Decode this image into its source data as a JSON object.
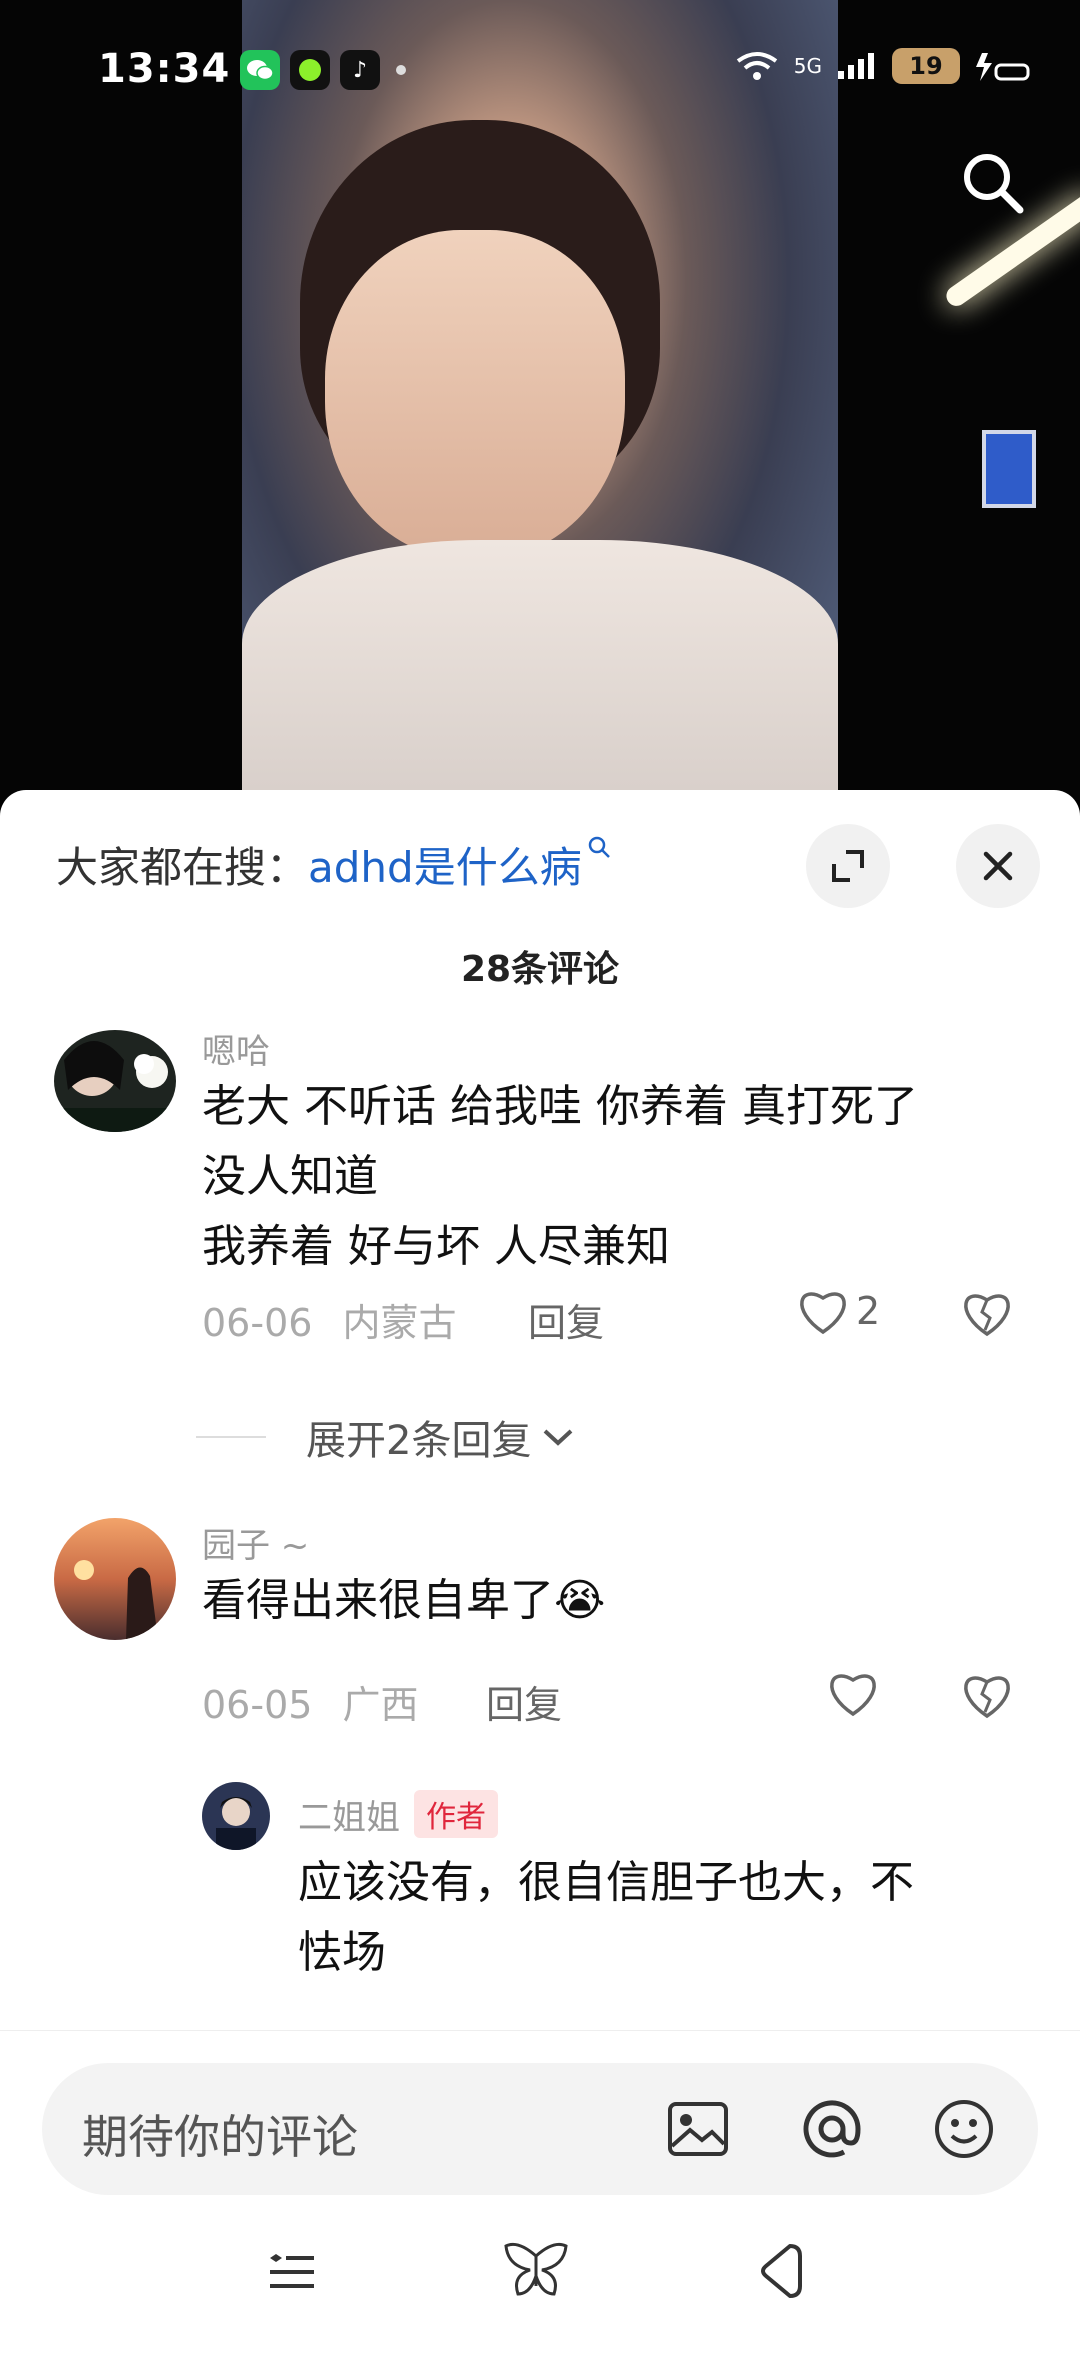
{
  "status_bar": {
    "time": "13:34",
    "network": "5G",
    "battery": "19"
  },
  "icons": {
    "search": "search-icon",
    "expand": "expand-icon",
    "close": "close-icon",
    "like": "heart-icon",
    "dislike": "broken-heart-icon",
    "image": "image-icon",
    "mention": "at-icon",
    "emoji": "smiley-icon"
  },
  "sheet": {
    "hot_search_prefix": "大家都在搜：",
    "hot_search_keyword": "adhd是什么病",
    "comment_count": "28条评论"
  },
  "comments": [
    {
      "username": "嗯哈",
      "lines": [
        "老大 不听话 给我哇  你养着 真打死了",
        "没人知道",
        "我养着 好与坏 人尽兼知"
      ],
      "date": "06-06",
      "location": "内蒙古",
      "reply_label": "回复",
      "likes": "2",
      "expand_label": "展开2条回复"
    },
    {
      "username": "园子 ~",
      "lines": [
        "看得出来很自卑了😭"
      ],
      "date": "06-05",
      "location": "广西",
      "reply_label": "回复",
      "likes": ""
    }
  ],
  "reply": {
    "username": "二姐姐",
    "badge": "作者",
    "lines": [
      "应该没有，很自信胆子也大，不",
      "怯场"
    ]
  },
  "input": {
    "placeholder": "期待你的评论"
  }
}
